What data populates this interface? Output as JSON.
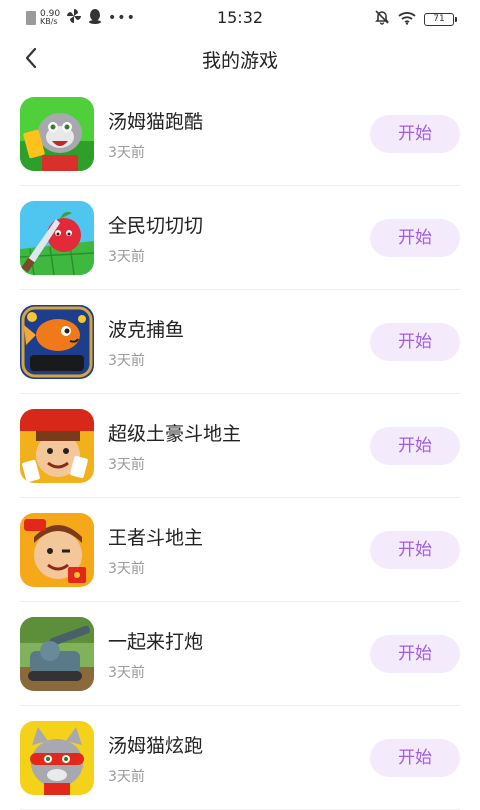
{
  "status_bar": {
    "speed_value": "0.90",
    "speed_unit": "KB/s",
    "time": "15:32",
    "battery": "71"
  },
  "header": {
    "title": "我的游戏",
    "back_icon": "back-arrow-icon"
  },
  "colors": {
    "accent": "#a35ce4",
    "button_bg": "#f3eafc"
  },
  "games": [
    {
      "name": "汤姆猫跑酷",
      "time": "3天前",
      "button": "开始",
      "icon": "talking-tom-gold-run-icon"
    },
    {
      "name": "全民切切切",
      "time": "3天前",
      "button": "开始",
      "icon": "fruit-knife-icon"
    },
    {
      "name": "波克捕鱼",
      "time": "3天前",
      "button": "开始",
      "icon": "fish-1000-icon"
    },
    {
      "name": "超级土豪斗地主",
      "time": "3天前",
      "button": "开始",
      "icon": "landlord-man-cards-icon"
    },
    {
      "name": "王者斗地主",
      "time": "3天前",
      "button": "开始",
      "icon": "landlord-red-envelope-icon"
    },
    {
      "name": "一起来打炮",
      "time": "3天前",
      "button": "开始",
      "icon": "tank-cannon-icon"
    },
    {
      "name": "汤姆猫炫跑",
      "time": "3天前",
      "button": "开始",
      "icon": "talking-tom-hero-icon"
    }
  ]
}
